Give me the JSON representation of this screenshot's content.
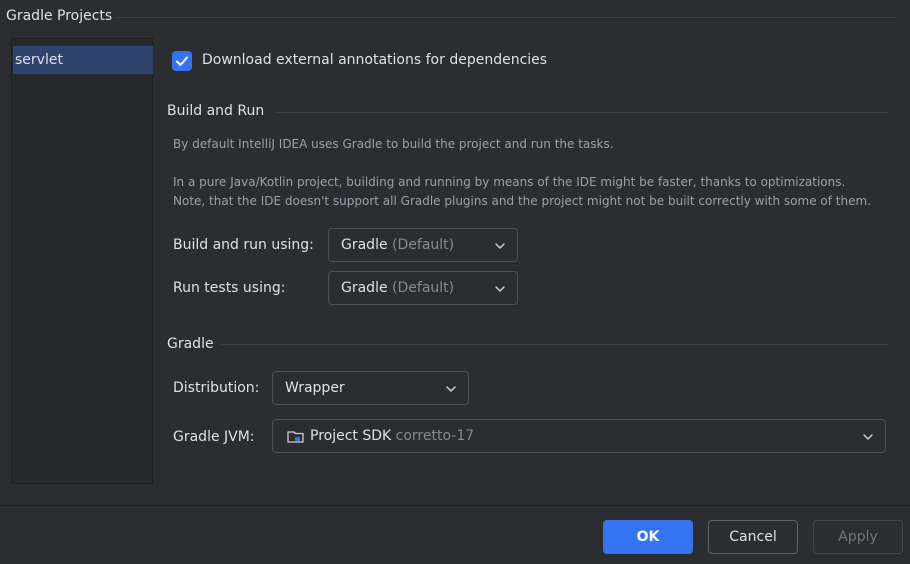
{
  "page": {
    "title": "Gradle Projects"
  },
  "projects": [
    {
      "label": "servlet",
      "selected": true
    }
  ],
  "download_annotations": {
    "label": "Download external annotations for dependencies",
    "checked": true
  },
  "build_and_run": {
    "title": "Build and Run",
    "desc1": "By default IntelliJ IDEA uses Gradle to build the project and run the tasks.",
    "desc2": "In a pure Java/Kotlin project, building and running by means of the IDE might be faster, thanks to optimizations.",
    "desc3": "Note, that the IDE doesn't support all Gradle plugins and the project might not be built correctly with some of them.",
    "build_run_label": "Build and run using:",
    "build_run_value": "Gradle",
    "build_run_hint": "(Default)",
    "run_tests_label": "Run tests using:",
    "run_tests_value": "Gradle",
    "run_tests_hint": "(Default)"
  },
  "gradle": {
    "title": "Gradle",
    "distribution_label": "Distribution:",
    "distribution_value": "Wrapper",
    "jvm_label": "Gradle JVM:",
    "jvm_value": "Project SDK",
    "jvm_hint": "corretto-17",
    "jvm_icon": "folder-sdk-icon"
  },
  "buttons": {
    "ok": "OK",
    "cancel": "Cancel",
    "apply": "Apply"
  },
  "colors": {
    "accent": "#3574f0",
    "background": "#2b2d30",
    "selection": "#2e436e"
  }
}
